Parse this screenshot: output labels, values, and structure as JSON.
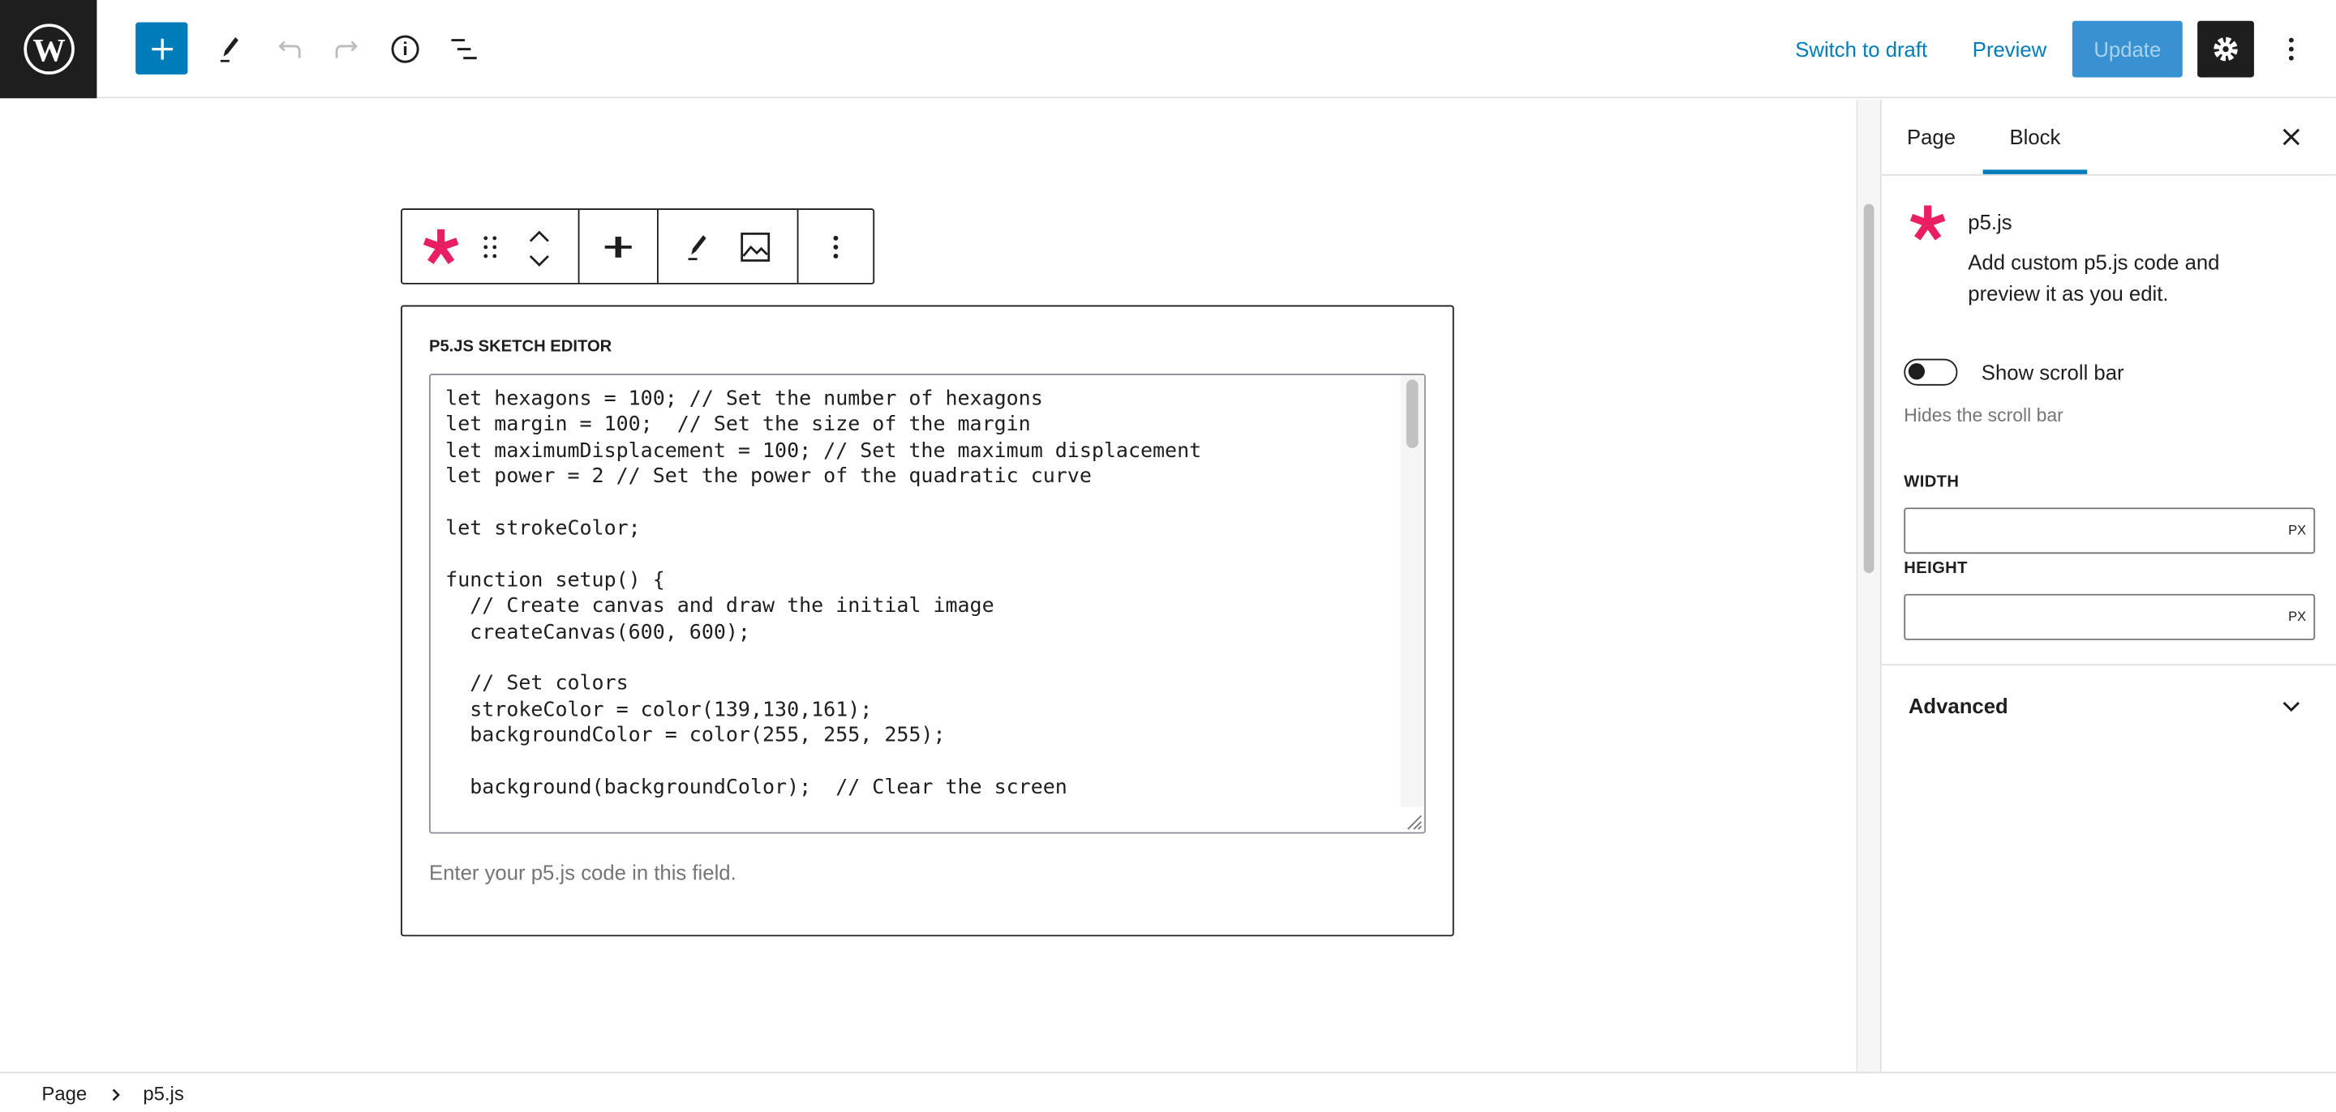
{
  "header": {
    "add_block_label": "+",
    "switch_to_draft": "Switch to draft",
    "preview": "Preview",
    "update": "Update",
    "icons": [
      "wordpress-logo",
      "plus-icon",
      "pen-icon",
      "undo-icon",
      "redo-icon",
      "info-icon",
      "list-view-icon",
      "gear-icon",
      "more-vertical-icon"
    ],
    "accent_color": "#007cba"
  },
  "block": {
    "editor_label": "P5.JS SKETCH EDITOR",
    "code": "let hexagons = 100; // Set the number of hexagons\nlet margin = 100;  // Set the size of the margin\nlet maximumDisplacement = 100; // Set the maximum displacement\nlet power = 2 // Set the power of the quadratic curve\n\nlet strokeColor;\n\nfunction setup() {\n  // Create canvas and draw the initial image\n  createCanvas(600, 600);\n\n  // Set colors\n  strokeColor = color(139,130,161);\n  backgroundColor = color(255, 255, 255);\n\n  background(backgroundColor);  // Clear the screen",
    "help": "Enter your p5.js code in this field.",
    "icon_color": "#e91e63"
  },
  "sidebar": {
    "tabs": [
      {
        "label": "Page"
      },
      {
        "label": "Block",
        "active": true
      }
    ],
    "block_name": "p5.js",
    "block_description": "Add custom p5.js code and preview it as you edit.",
    "toggle_label": "Show scroll bar",
    "toggle_on": false,
    "toggle_help": "Hides the scroll bar",
    "width_label": "WIDTH",
    "width_value": "",
    "width_unit": "PX",
    "height_label": "HEIGHT",
    "height_value": "",
    "height_unit": "PX",
    "advanced": "Advanced"
  },
  "breadcrumb": {
    "root": "Page",
    "current": "p5.js"
  }
}
